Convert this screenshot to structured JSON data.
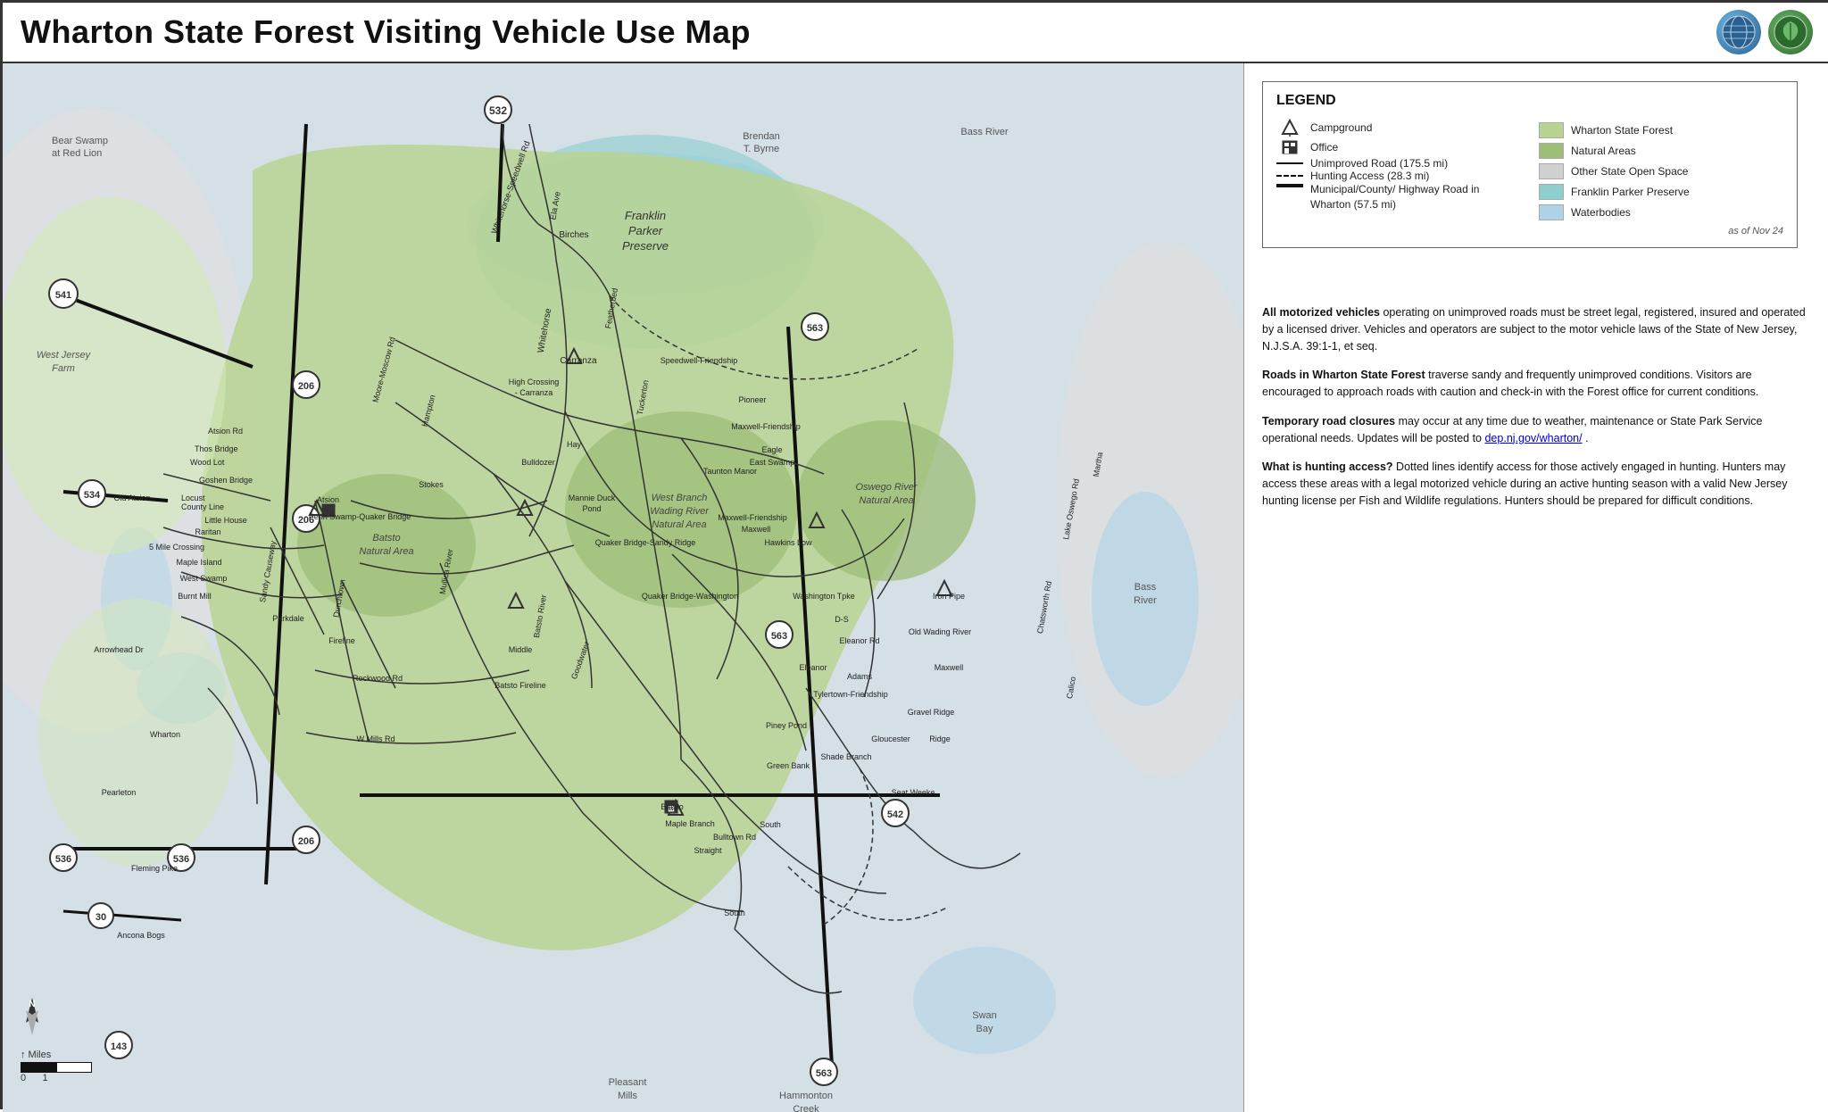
{
  "title": "Wharton State Forest Visiting Vehicle Use Map",
  "logos": {
    "globe": "🌐",
    "leaf": "🌿"
  },
  "legend": {
    "title": "LEGEND",
    "items": [
      {
        "symbol": "campground",
        "label": "Campground"
      },
      {
        "symbol": "office",
        "label": "Office"
      },
      {
        "symbol": "solid-line",
        "label": "Unimproved Road (175.5 mi)"
      },
      {
        "symbol": "dashed-line",
        "label": "Hunting Access (28.3 mi)"
      },
      {
        "symbol": "thick-line",
        "label": "Municipal/County/ Highway Road in Wharton (57.5 mi)"
      }
    ],
    "colors": [
      {
        "color": "#b8d490",
        "label": "Wharton State Forest"
      },
      {
        "color": "#8fbb62",
        "label": "Natural Areas"
      },
      {
        "color": "#d0d0d0",
        "label": "Other State Open Space"
      },
      {
        "color": "#8ecece",
        "label": "Franklin Parker Preserve"
      },
      {
        "color": "#aed3e8",
        "label": "Waterbodies"
      }
    ],
    "date": "as of Nov 24"
  },
  "info_sections": [
    {
      "id": "motorized",
      "bold_prefix": "All motorized vehicles",
      "text": " operating on unimproved roads must be street legal, registered, insured and operated by a licensed driver. Vehicles and operators are subject to the motor vehicle laws of the State of New Jersey, N.J.S.A. 39:1-1, et seq."
    },
    {
      "id": "roads",
      "bold_prefix": "Roads in Wharton State Forest",
      "text": " traverse sandy and frequently unimproved conditions. Visitors are encouraged to approach roads with caution and check-in with the Forest office for current conditions."
    },
    {
      "id": "closure",
      "bold_prefix": "Temporary road closures",
      "text": " may occur at any time due to weather, maintenance or State Park Service operational needs. Updates will be posted to ",
      "link": "dep.nj.gov/wharton/",
      "text_after": "."
    },
    {
      "id": "hunting",
      "bold_prefix": "What is hunting access?",
      "text": " Dotted lines identify access for those actively engaged in hunting. Hunters may access these areas with a legal motorized vehicle during an active hunting season with a valid New Jersey hunting license per Fish and Wildlife regulations. Hunters should be prepared for difficult conditions."
    }
  ],
  "scale": {
    "label": "Miles",
    "value": "1"
  },
  "map_labels": {
    "bear_swamp": "Bear Swamp\nat Red Lion",
    "franklin_parker": "Franklin\nParker\nPreserve",
    "brendan_byrne": "Brendan\nT. Byrne",
    "bass_river": "Bass River",
    "west_branch": "West Branch\nWading River\nNatural Area",
    "batsto_natural": "Batsto\nNatural Area",
    "oswego_natural": "Oswego River\nNatural Area",
    "pleasant_mills": "Pleasant\nMills",
    "hammonton_creek": "Hammonton\nCreek",
    "swan_bay": "Swan\nBay"
  },
  "routes": [
    "532",
    "541",
    "206",
    "534",
    "536",
    "30",
    "143",
    "563",
    "542"
  ],
  "campground_locations": [
    {
      "name": "Carranza",
      "label": "Carranza"
    },
    {
      "name": "Atsion-campground",
      "label": ""
    },
    {
      "name": "Quaker-Bridge",
      "label": ""
    },
    {
      "name": "Maxwell",
      "label": ""
    },
    {
      "name": "Batsto-north",
      "label": ""
    },
    {
      "name": "Batsto-main",
      "label": "Batsto"
    },
    {
      "name": "Eleanor-campground",
      "label": ""
    }
  ],
  "roads": [
    "Whitehorse-Speedwell Rd",
    "Whitehorse",
    "Birches",
    "Carranza",
    "High Crossing - Carranza",
    "Hampton",
    "Tuckerton",
    "Hay",
    "Bulldozer",
    "Stokes",
    "Mannie Duck Pond",
    "Penn Swamp",
    "Quaker Bridge",
    "Mullica River",
    "Batsto River",
    "Middle",
    "Goodwater",
    "Batsto Fireline",
    "Fireline",
    "Rockwood Rd",
    "W Mills Rd",
    "Sandy Causeway",
    "Durchtown",
    "Fleming",
    "Parkdale",
    "Burnt Mill",
    "West Swamp",
    "Maple Island",
    "Raritan",
    "5 Mile Crossing",
    "Little House",
    "County Line",
    "Goshen Bridge",
    "Wood Lot",
    "Locust",
    "Old Atsion",
    "Thos Bridge",
    "Atsion Rd",
    "Penn Swamp-Quaker Bridge",
    "Sandy Ridge",
    "Quaker Bridge-Sandy Ridge",
    "Quaker Bridge-Washington",
    "Washington Tpke",
    "Iron Pipe",
    "Hawkins Low",
    "Maxwell-Friendship",
    "D-S",
    "Eleanor Rd",
    "Tylertown-Friendship",
    "Piney Pond",
    "Bulltown Rd",
    "Maple Branch",
    "Straight",
    "Seat Weeke",
    "South",
    "Old Wading River",
    "Maxwell-Ridge",
    "Chatsworth Rd",
    "Calico",
    "Martha",
    "Lake Oswego Rd",
    "Featherbed",
    "Pioneer",
    "Maxwell-Friendship",
    "Eagle",
    "Taunton Manor",
    "East Swamp",
    "Speedwell-Friendship",
    "Green Bank",
    "Shade Branch",
    "Gloucester",
    "Gravel Ridge",
    "Arrowhead Dr",
    "Pearleton",
    "Fleming Pike",
    "Ancona Bogs"
  ]
}
